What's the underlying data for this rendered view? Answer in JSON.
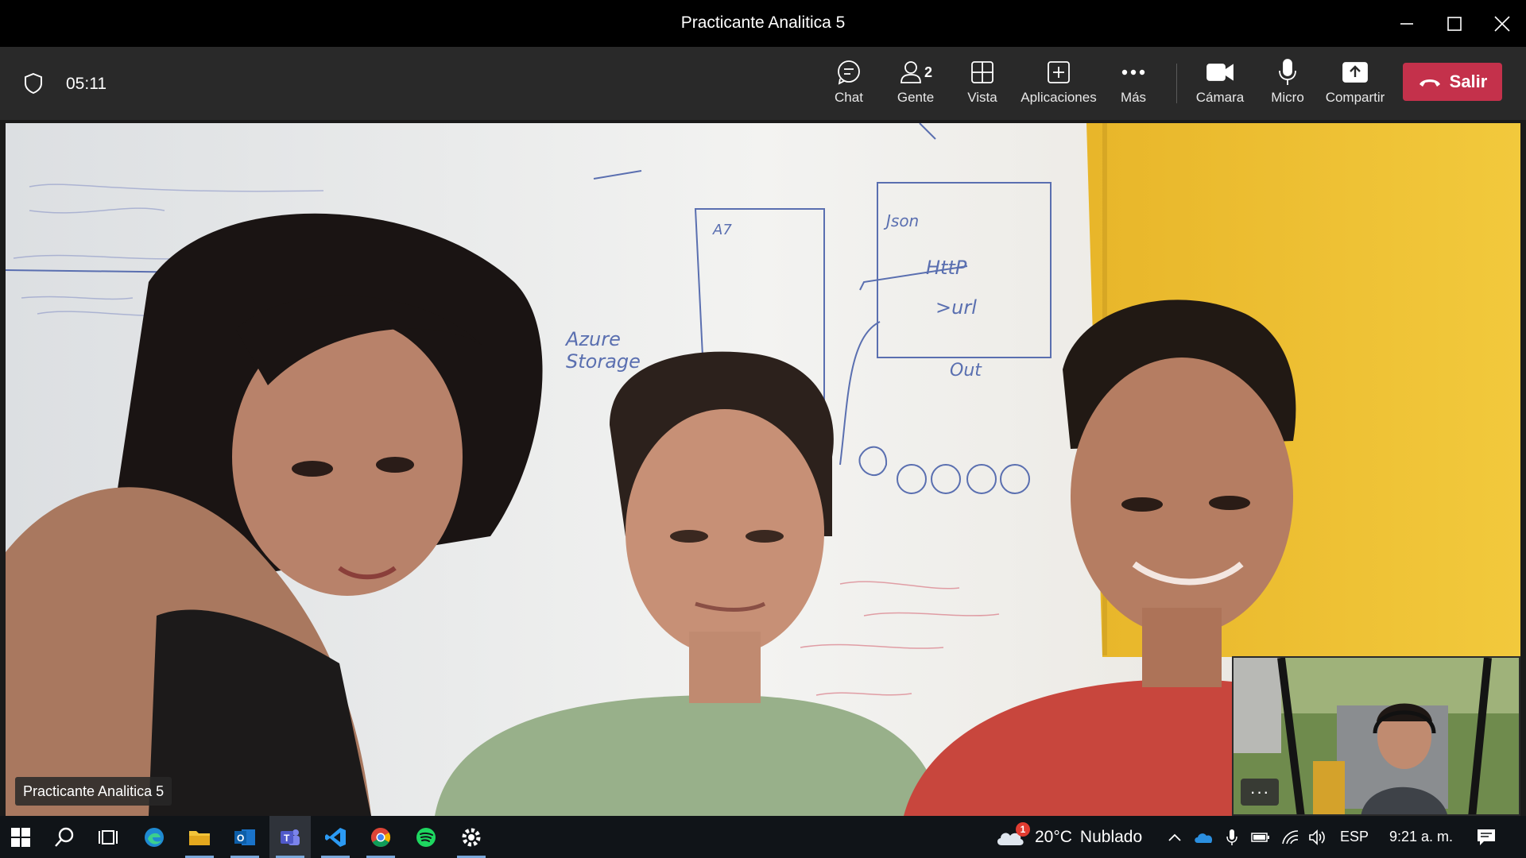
{
  "window": {
    "title": "Practicante Analitica 5"
  },
  "meeting": {
    "timer": "05:11"
  },
  "toolbar": {
    "chat": "Chat",
    "people": "Gente",
    "people_count": "2",
    "view": "Vista",
    "apps": "Aplicaciones",
    "more": "Más",
    "camera": "Cámara",
    "mic": "Micro",
    "share": "Compartir",
    "leave": "Salir"
  },
  "video": {
    "participant_name": "Practicante Analitica 5",
    "whiteboard_text": {
      "azure": "Azure",
      "storage": "Storage",
      "json": "Json",
      "http": "HttP",
      "url": ">url",
      "out": "Out",
      "a7": "A7"
    }
  },
  "taskbar": {
    "apps": [
      "start-icon",
      "search-icon",
      "task-view-icon",
      "edge-icon",
      "file-explorer-icon",
      "outlook-icon",
      "teams-icon",
      "vscode-icon",
      "chrome-icon",
      "spotify-icon",
      "settings-icon"
    ],
    "weather_temp": "20°C",
    "weather_desc": "Nublado",
    "weather_badge": "1",
    "language": "ESP",
    "clock": "9:21 a. m."
  },
  "colors": {
    "leave_red": "#c4314b",
    "toolbar_bg": "#292929",
    "wall_yellow": "#f0c232"
  }
}
